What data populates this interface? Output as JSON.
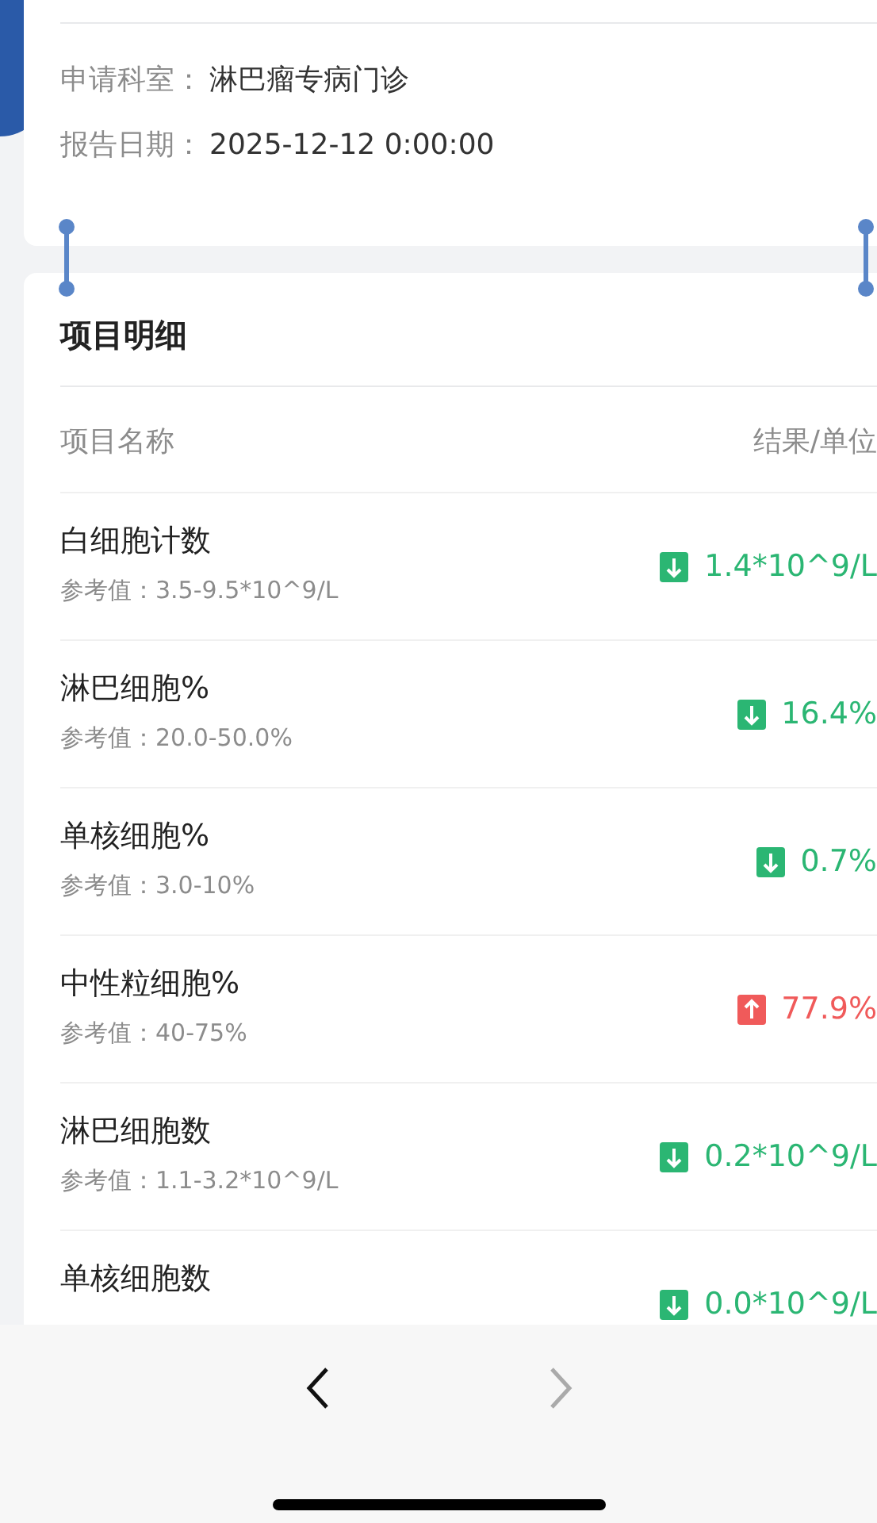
{
  "report_info": [
    {
      "label": "申请科室：",
      "value": "淋巴瘤专病门诊"
    },
    {
      "label": "报告日期：",
      "value": "2025-12-12 0:00:00"
    }
  ],
  "details": {
    "title": "项目明细",
    "columns": [
      "项目名称",
      "结果/单位"
    ],
    "rows": [
      {
        "name": "白细胞计数",
        "reference": "参考值：3.5-9.5*10^9/L",
        "result": "1.4*10^9/L",
        "kind": "low"
      },
      {
        "name": "淋巴细胞%",
        "reference": "参考值：20.0-50.0%",
        "result": "16.4%",
        "kind": "low"
      },
      {
        "name": "单核细胞%",
        "reference": "参考值：3.0-10%",
        "result": "0.7%",
        "kind": "low"
      },
      {
        "name": "中性粒细胞%",
        "reference": "参考值：40-75%",
        "result": "77.9%",
        "kind": "high"
      },
      {
        "name": "淋巴细胞数",
        "reference": "参考值：1.1-3.2*10^9/L",
        "result": "0.2*10^9/L",
        "kind": "low"
      },
      {
        "name": "单核细胞数",
        "result": "0.0*10^9/L",
        "kind": "low"
      }
    ]
  },
  "browser_nav": {
    "back_disabled": false,
    "forward_disabled": true
  }
}
